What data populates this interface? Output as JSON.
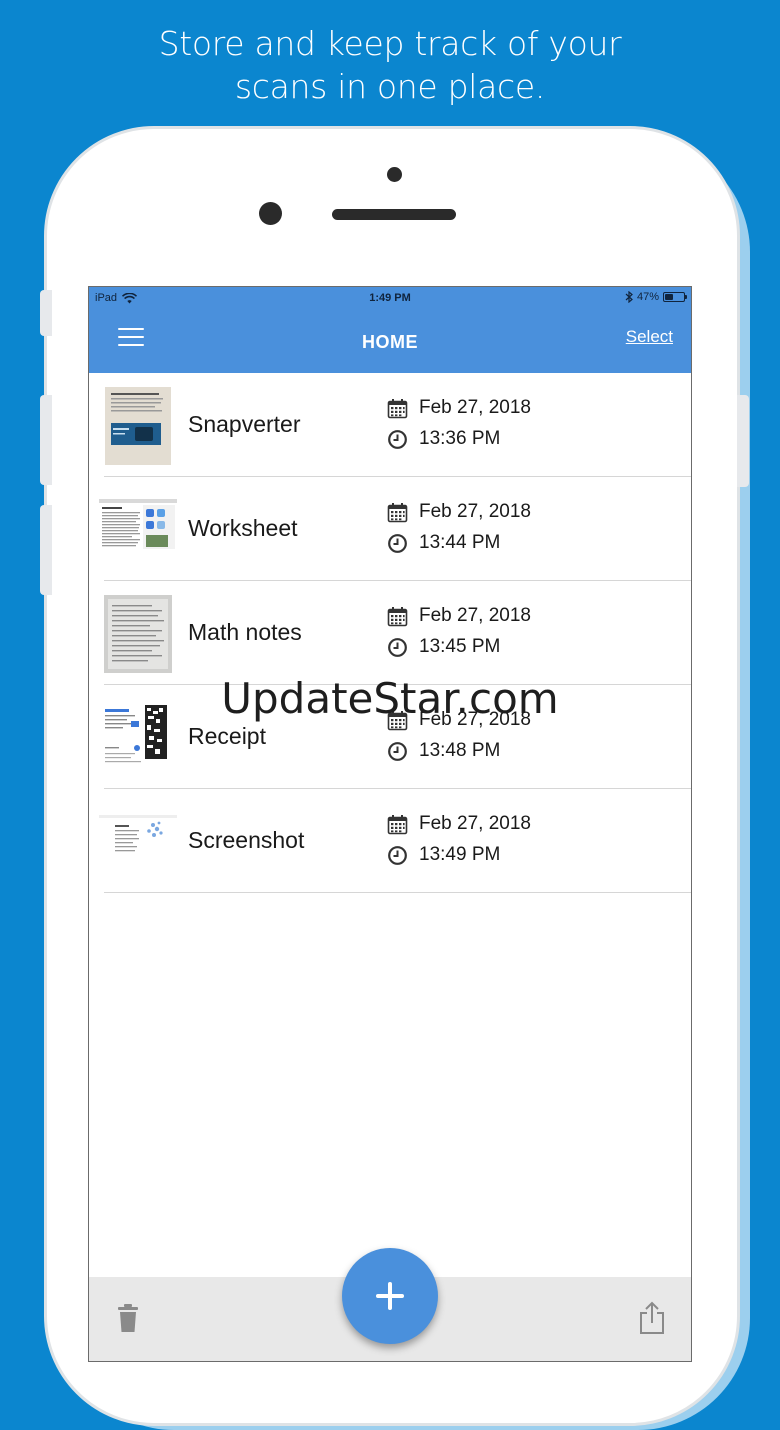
{
  "headline": {
    "line1": "Store and keep track of your",
    "line2": "scans in one place."
  },
  "status_bar": {
    "device": "iPad",
    "time": "1:49 PM",
    "battery_text": "47%",
    "battery_level": 0.47
  },
  "nav": {
    "title": "HOME",
    "select_label": "Select",
    "menu_icon": "hamburger-menu-icon"
  },
  "documents": [
    {
      "name": "Snapverter",
      "date": "Feb 27, 2018",
      "time": "13:36 PM"
    },
    {
      "name": "Worksheet",
      "date": "Feb 27, 2018",
      "time": "13:44 PM"
    },
    {
      "name": "Math notes",
      "date": "Feb 27, 2018",
      "time": "13:45 PM"
    },
    {
      "name": "Receipt",
      "date": "Feb 27, 2018",
      "time": "13:48 PM"
    },
    {
      "name": "Screenshot",
      "date": "Feb 27, 2018",
      "time": "13:49 PM"
    }
  ],
  "watermark": "UpdateStar.com",
  "bottom_bar": {
    "left_icon": "trash-icon",
    "fab_icon": "plus-icon",
    "right_icon": "share-icon"
  },
  "colors": {
    "background": "#0b86cf",
    "accent": "#4a90dc",
    "bottom_bar": "#e8e8e8"
  }
}
